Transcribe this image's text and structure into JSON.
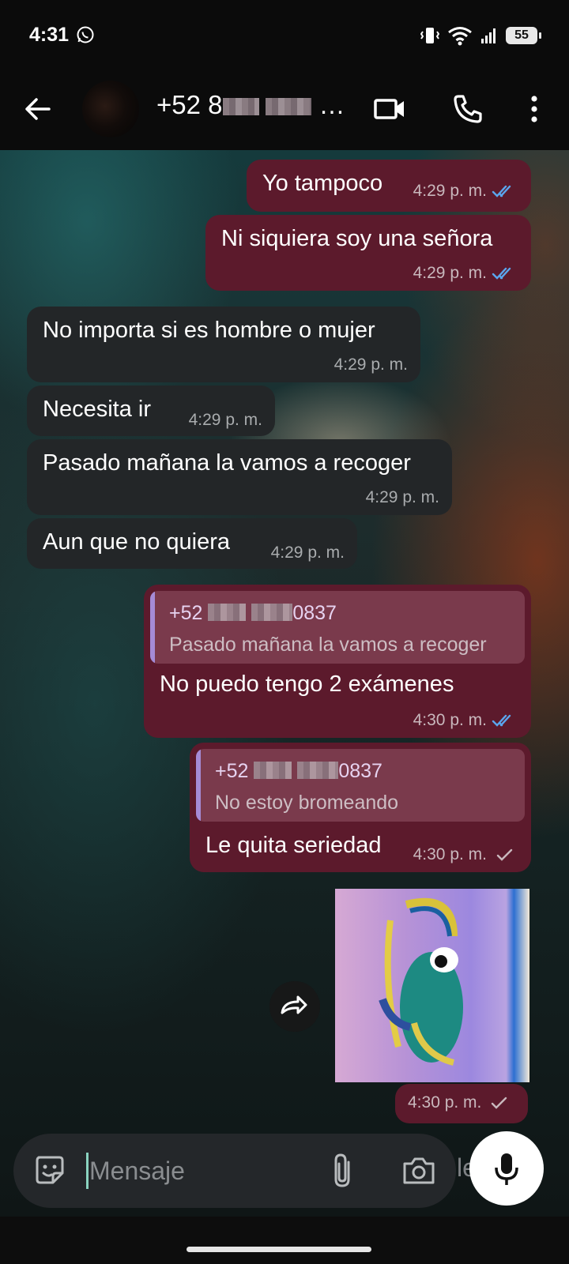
{
  "status_bar": {
    "time": "4:31",
    "battery": "55",
    "icons": [
      "whatsapp-icon",
      "vibrate-icon",
      "wifi-icon",
      "signal-icon",
      "battery-icon"
    ]
  },
  "header": {
    "contact_name_prefix": "+52 8",
    "contact_name_suffix": "0...",
    "icons": [
      "back-arrow-icon",
      "video-call-icon",
      "phone-icon",
      "more-vert-icon"
    ]
  },
  "messages": [
    {
      "id": "m1",
      "direction": "out",
      "text": "Yo tampoco",
      "time": "4:29 p. m.",
      "status": "read"
    },
    {
      "id": "m2",
      "direction": "out",
      "text": "Ni siquiera soy una señora",
      "time": "4:29 p. m.",
      "status": "read"
    },
    {
      "id": "m3",
      "direction": "in",
      "text": "No importa si es hombre o mujer",
      "time": "4:29 p. m."
    },
    {
      "id": "m4",
      "direction": "in",
      "text": "Necesita ir",
      "time": "4:29 p. m."
    },
    {
      "id": "m5",
      "direction": "in",
      "text": "Pasado mañana la vamos a recoger",
      "time": "4:29 p. m."
    },
    {
      "id": "m6",
      "direction": "in",
      "text": "Aun que no quiera",
      "time": "4:29 p. m."
    },
    {
      "id": "m7",
      "direction": "out",
      "reply_name_prefix": "+52",
      "reply_name_suffix": "0837",
      "reply_text": "Pasado mañana la vamos a recoger",
      "text": "No puedo tengo 2 exámenes",
      "time": "4:30 p. m.",
      "status": "read"
    },
    {
      "id": "m8",
      "direction": "out",
      "reply_name_prefix": "+52",
      "reply_name_suffix": "0837",
      "reply_text": "No estoy bromeando",
      "text": "Le quita seriedad",
      "time": "4:30 p. m.",
      "status": "sent"
    },
    {
      "id": "m9",
      "direction": "out",
      "type": "sticker",
      "time": "4:30 p. m.",
      "status": "sent"
    }
  ],
  "input": {
    "placeholder": "Mensaje",
    "ghost_text": "le",
    "icons": [
      "sticker-emoji-icon",
      "attach-clip-icon",
      "camera-icon",
      "mic-icon"
    ]
  },
  "colors": {
    "outgoing_bubble": "#5c1a2c",
    "incoming_bubble": "#232628",
    "read_check": "#5aa6ee",
    "reply_bar": "#a58bd6"
  }
}
